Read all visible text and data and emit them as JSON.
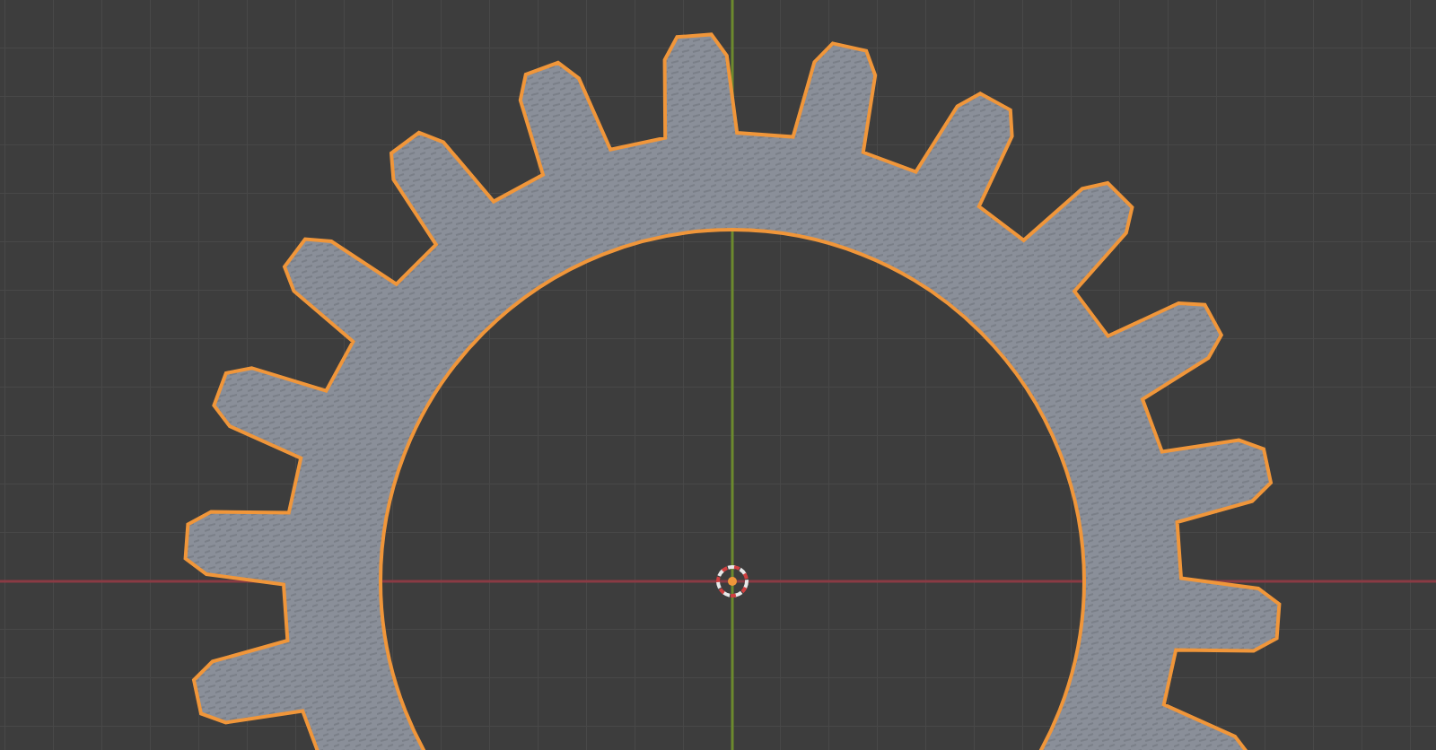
{
  "viewport": {
    "object_selected": true
  }
}
